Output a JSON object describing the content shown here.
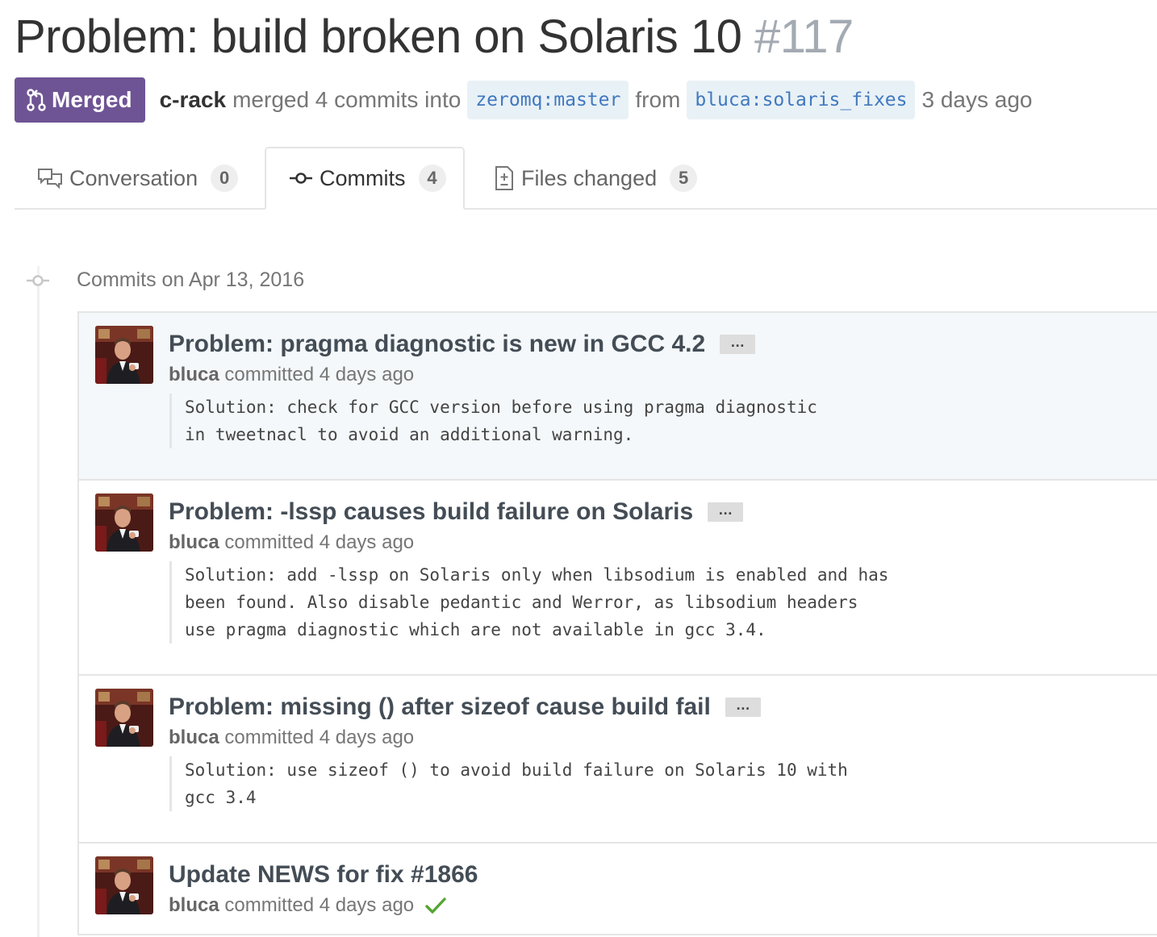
{
  "pr": {
    "title": "Problem: build broken on Solaris 10",
    "number": "#117",
    "state": "Merged",
    "author": "c-rack",
    "merge_text": "merged 4 commits into",
    "base_repo": "zeromq",
    "base_branch": "master",
    "from_text": "from",
    "head_repo": "bluca",
    "head_branch": "solaris_fixes",
    "time_ago": "3 days ago"
  },
  "tabs": [
    {
      "label": "Conversation",
      "count": "0",
      "icon": "comment-discussion-icon"
    },
    {
      "label": "Commits",
      "count": "4",
      "icon": "git-commit-icon"
    },
    {
      "label": "Files changed",
      "count": "5",
      "icon": "diff-icon"
    }
  ],
  "commit_group": {
    "title": "Commits on Apr 13, 2016"
  },
  "commits": [
    {
      "title": "Problem: pragma diagnostic is new in GCC 4.2",
      "author": "bluca",
      "when": "committed 4 days ago",
      "ellipsis": "…",
      "description": "Solution: check for GCC version before using pragma diagnostic\nin tweetnacl to avoid an additional warning."
    },
    {
      "title": "Problem: -lssp causes build failure on Solaris",
      "author": "bluca",
      "when": "committed 4 days ago",
      "ellipsis": "…",
      "description": "Solution: add -lssp on Solaris only when libsodium is enabled and has\nbeen found. Also disable pedantic and Werror, as libsodium headers\nuse pragma diagnostic which are not available in gcc 3.4."
    },
    {
      "title": "Problem: missing () after sizeof cause build fail",
      "author": "bluca",
      "when": "committed 4 days ago",
      "ellipsis": "…",
      "description": "Solution: use sizeof () to avoid build failure on Solaris 10 with\ngcc 3.4"
    },
    {
      "title": "Update NEWS for fix #1866",
      "author": "bluca",
      "when": "committed 4 days ago",
      "status": "check-icon"
    }
  ],
  "colors": {
    "merged": "#6e5494",
    "branch_bg": "#e8f1f6",
    "branch_text": "#4078c0",
    "success": "#55a532",
    "highlight_row": "#f4f8fa"
  }
}
